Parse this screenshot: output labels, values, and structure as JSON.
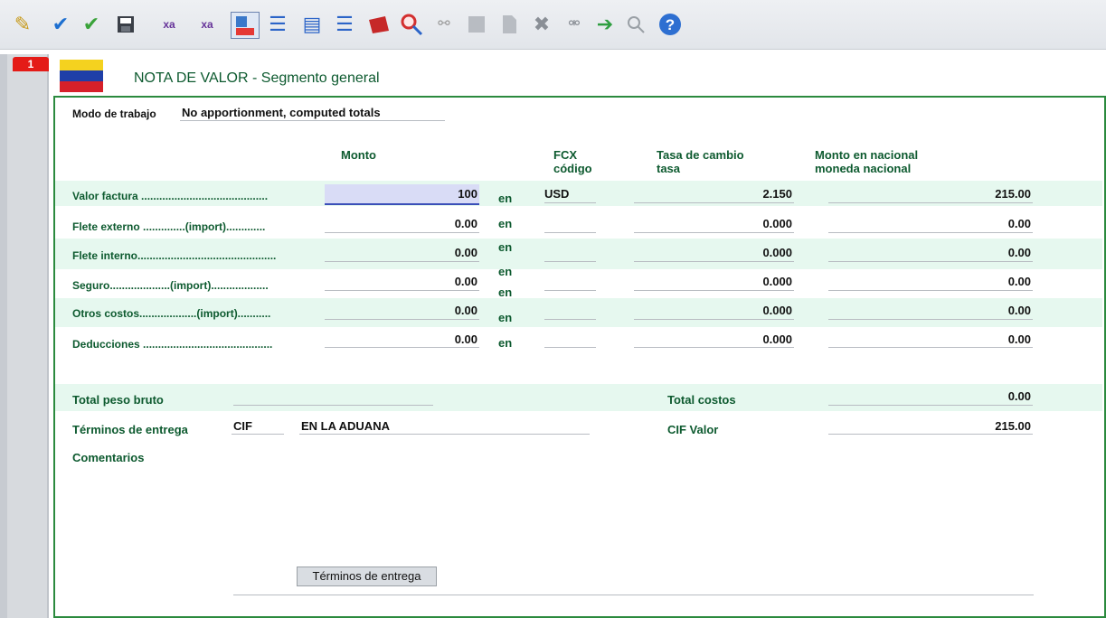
{
  "toolbar": {
    "icons": [
      "magic-wand-icon",
      "check-icon",
      "check-icon",
      "save-icon",
      "xml-export-icon",
      "xml-import-icon",
      "xml-document-icon",
      "print-icon",
      "print-icon",
      "print-icon",
      "pdf-icon",
      "find-icon",
      "link-icon",
      "edit-icon",
      "document-icon",
      "delete-icon",
      "view-icon",
      "forward-arrow-icon",
      "zoom-icon",
      "help-icon"
    ]
  },
  "side_tab": {
    "number": "1"
  },
  "header": {
    "title": "NOTA DE VALOR - Segmento general"
  },
  "mode": {
    "label": "Modo de trabajo",
    "value": "No apportionment, computed totals"
  },
  "columns": {
    "monto": "Monto",
    "fcx_line1": "FCX",
    "fcx_line2": "código",
    "tasa_line1": "Tasa de cambio",
    "tasa_line2": "tasa",
    "nacional_line1": "Monto en nacional",
    "nacional_line2": "moneda nacional"
  },
  "rows": [
    {
      "label": "Valor factura ..........................................",
      "monto": "100",
      "en": "en",
      "code": "USD",
      "rate": "2.150",
      "national": "215.00"
    },
    {
      "label": "Flete externo ..............(import).............",
      "monto": "0.00",
      "en": "en",
      "code": "",
      "rate": "0.000",
      "national": "0.00"
    },
    {
      "label": "Flete interno..............................................",
      "monto": "0.00",
      "en": "en",
      "code": "",
      "rate": "0.000",
      "national": "0.00"
    },
    {
      "label": "Seguro....................(import)...................",
      "monto": "0.00",
      "en": "en",
      "code": "",
      "rate": "0.000",
      "national": "0.00"
    },
    {
      "label": "Otros costos...................(import)...........",
      "monto": "0.00",
      "en": "en",
      "code": "",
      "rate": "0.000",
      "national": "0.00"
    },
    {
      "label": "Deducciones ...........................................",
      "monto": "0.00",
      "en": "en",
      "code": "",
      "rate": "0.000",
      "national": "0.00"
    }
  ],
  "en_label": "en",
  "totals": {
    "peso_label": "Total peso bruto",
    "terminos_label": "Términos de entrega",
    "terminos_code": "CIF",
    "terminos_place": "EN LA ADUANA",
    "costos_label": "Total costos",
    "costos_value": "0.00",
    "cif_label": "CIF Valor",
    "cif_value": "215.00",
    "comentarios_label": "Comentarios"
  },
  "buttons": {
    "terminos": "Términos de entrega"
  },
  "colors": {
    "accent_green": "#0d5a2f",
    "frame_green": "#2b8a3e",
    "band": "#e6f8ef",
    "tab_red": "#e41b17"
  }
}
